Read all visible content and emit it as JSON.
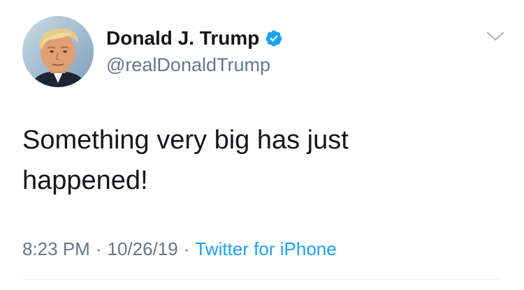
{
  "user": {
    "display_name": "Donald J. Trump",
    "handle": "@realDonaldTrump",
    "verified": true,
    "avatar_icon": "profile-photo",
    "verified_icon": "verified-badge-icon"
  },
  "tweet": {
    "text": "Something very big has just happened!",
    "time": "8:23 PM",
    "date": "10/26/19",
    "separator": "·",
    "source": "Twitter for iPhone"
  },
  "menu": {
    "icon": "chevron-down-icon"
  },
  "colors": {
    "text": "#14171a",
    "secondary": "#657786",
    "link": "#1da1f2",
    "verified": "#1da1f2",
    "divider": "#e6ecf0"
  }
}
